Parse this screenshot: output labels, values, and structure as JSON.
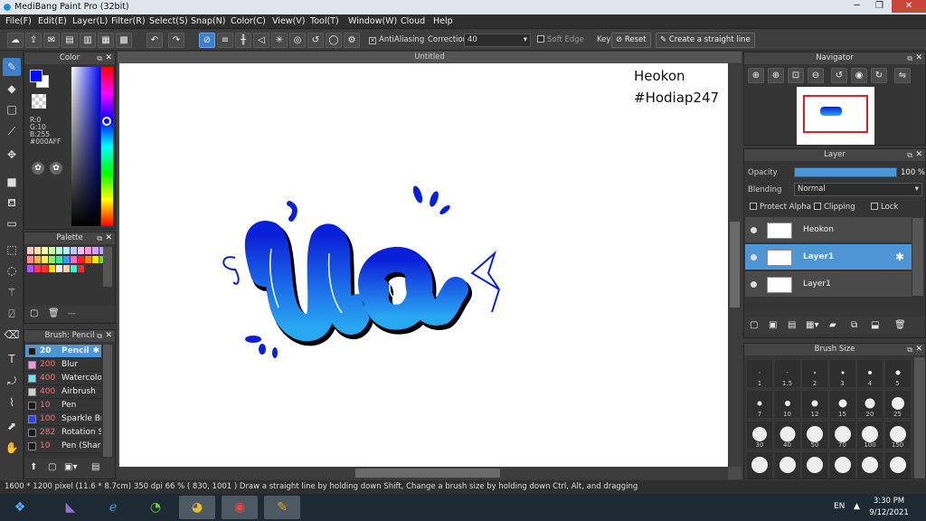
{
  "title_bar": {
    "title": "MediBang Paint Pro (32bit)"
  },
  "menu": [
    "File(F)",
    "Edit(E)",
    "Layer(L)",
    "Filter(R)",
    "Select(S)",
    "Snap(N)",
    "Color(C)",
    "View(V)",
    "Tool(T)",
    "Window(W)",
    "Cloud",
    "Help"
  ],
  "toolbar": {
    "antialiasing_label": "AntiAliasing",
    "correction_label": "Correction",
    "correction_value": "40",
    "soft_edge_label": "Soft Edge",
    "key_label": "Key",
    "reset_label": "Reset",
    "straight_line_label": "Create a straight line"
  },
  "color_panel": {
    "title": "Color",
    "r": "R:0",
    "g": "G:10",
    "b": "B:255",
    "hex": "#000AFF",
    "fg_color": "#000AFF",
    "bg_color": "#FFFFFF"
  },
  "palette_panel": {
    "title": "Palette",
    "counter": "---"
  },
  "brush_panel": {
    "title": "Brush: Pencil",
    "brushes": [
      {
        "size": "20",
        "name": "Pencil",
        "color": "#1a1a1a"
      },
      {
        "size": "200",
        "name": "Blur",
        "color": "#e99ad8"
      },
      {
        "size": "400",
        "name": "Watercolor",
        "color": "#6fe0f0"
      },
      {
        "size": "400",
        "name": "Airbrush",
        "color": "#cfcfcf"
      },
      {
        "size": "10",
        "name": "Pen",
        "color": "#1a1a1a"
      },
      {
        "size": "100",
        "name": "Sparkle Brush",
        "color": "#2f48d8"
      },
      {
        "size": "282",
        "name": "Rotation Symmetry",
        "color": "#1a1a1a"
      },
      {
        "size": "10",
        "name": "Pen (Sharp)",
        "color": "#1a1a1a"
      }
    ]
  },
  "canvas": {
    "tab_title": "Untitled",
    "watermark_line1": "Heokon",
    "watermark_line2": "#Hodiap247"
  },
  "navigator": {
    "title": "Navigator"
  },
  "layer_panel": {
    "title": "Layer",
    "opacity_label": "Opacity",
    "opacity_value": "100 %",
    "opacity_fraction": 1.0,
    "blending_label": "Blending",
    "blending_value": "Normal",
    "protect_alpha_label": "Protect Alpha",
    "clipping_label": "Clipping",
    "lock_label": "Lock",
    "layers": [
      {
        "name": "Heokon",
        "selected": false
      },
      {
        "name": "Layer1",
        "selected": true
      },
      {
        "name": "Layer1",
        "selected": false
      }
    ]
  },
  "brush_size": {
    "title": "Brush Size",
    "sizes": [
      "1",
      "1.5",
      "2",
      "3",
      "4",
      "5",
      "7",
      "10",
      "12",
      "15",
      "20",
      "25",
      "30",
      "40",
      "50",
      "70",
      "100",
      "150"
    ]
  },
  "status_bar": {
    "text": "1600 * 1200 pixel  (11.6 * 8.7cm)  350 dpi  66 %  ( 830, 1001 )  Draw a straight line by holding down Shift, Change a brush size by holding down Ctrl, Alt, and dragging"
  },
  "taskbar": {
    "lang": "EN",
    "time": "3:30 PM",
    "date": "9/12/2021"
  }
}
